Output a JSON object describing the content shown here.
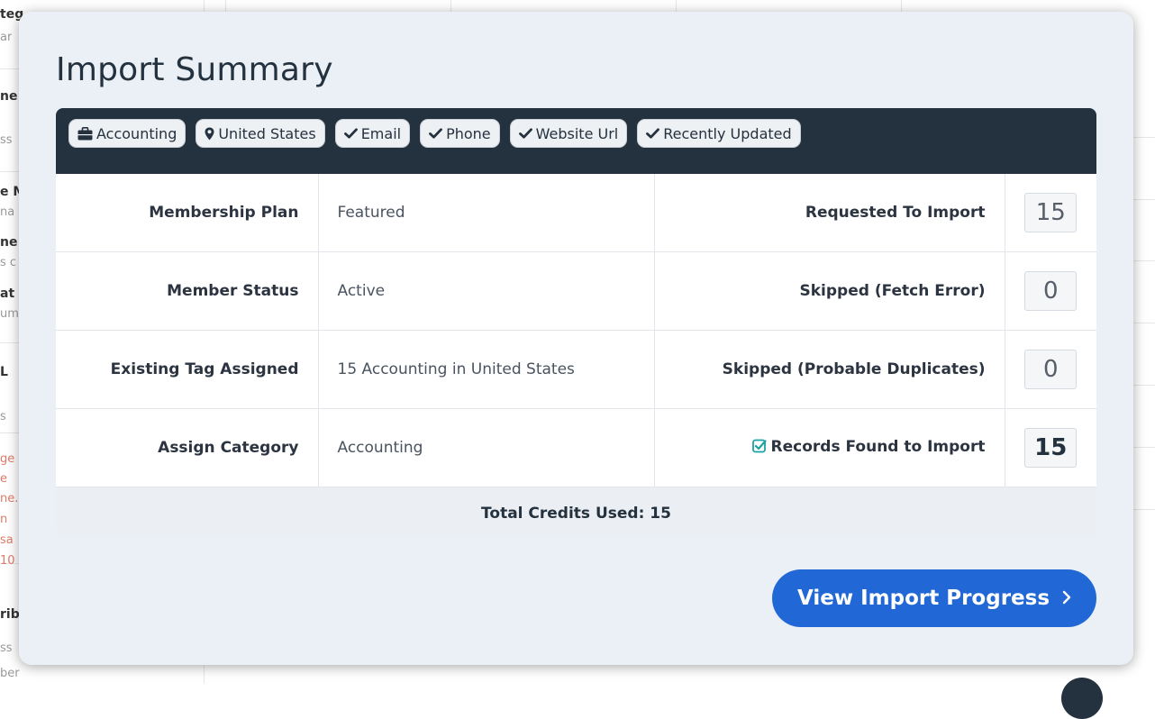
{
  "background": {
    "fragments": [
      "teg",
      "ar",
      "ne",
      "ss",
      "e M",
      "na",
      "ne",
      "s c",
      "at",
      "ume",
      "L",
      "s",
      "ge",
      "e",
      "ne.",
      "n",
      "sa",
      "10",
      "rib",
      "ss",
      "ber"
    ]
  },
  "modal": {
    "title": "Import Summary",
    "filters": [
      {
        "icon": "briefcase-icon",
        "label": "Accounting"
      },
      {
        "icon": "map-marker-icon",
        "label": "United States"
      },
      {
        "icon": "check-icon",
        "label": "Email"
      },
      {
        "icon": "check-icon",
        "label": "Phone"
      },
      {
        "icon": "check-icon",
        "label": "Website Url"
      },
      {
        "icon": "check-icon",
        "label": "Recently Updated"
      }
    ],
    "rows": [
      {
        "label": "Membership Plan",
        "value": "Featured",
        "stat_label": "Requested To Import",
        "stat_value": "15"
      },
      {
        "label": "Member Status",
        "value": "Active",
        "stat_label": "Skipped (Fetch Error)",
        "stat_value": "0"
      },
      {
        "label": "Existing Tag Assigned",
        "value": "15 Accounting in United States",
        "stat_label": "Skipped (Probable Duplicates)",
        "stat_value": "0"
      },
      {
        "label": "Assign Category",
        "value": "Accounting",
        "stat_label": "Records Found to Import",
        "stat_value": "15"
      }
    ],
    "total": "Total Credits Used: 15",
    "cta_label": "View Import Progress"
  },
  "colors": {
    "dark_navy": "#24313f",
    "primary_blue": "#2267d6",
    "check_teal": "#1aa3a3",
    "modal_bg": "#ebf0f6"
  }
}
